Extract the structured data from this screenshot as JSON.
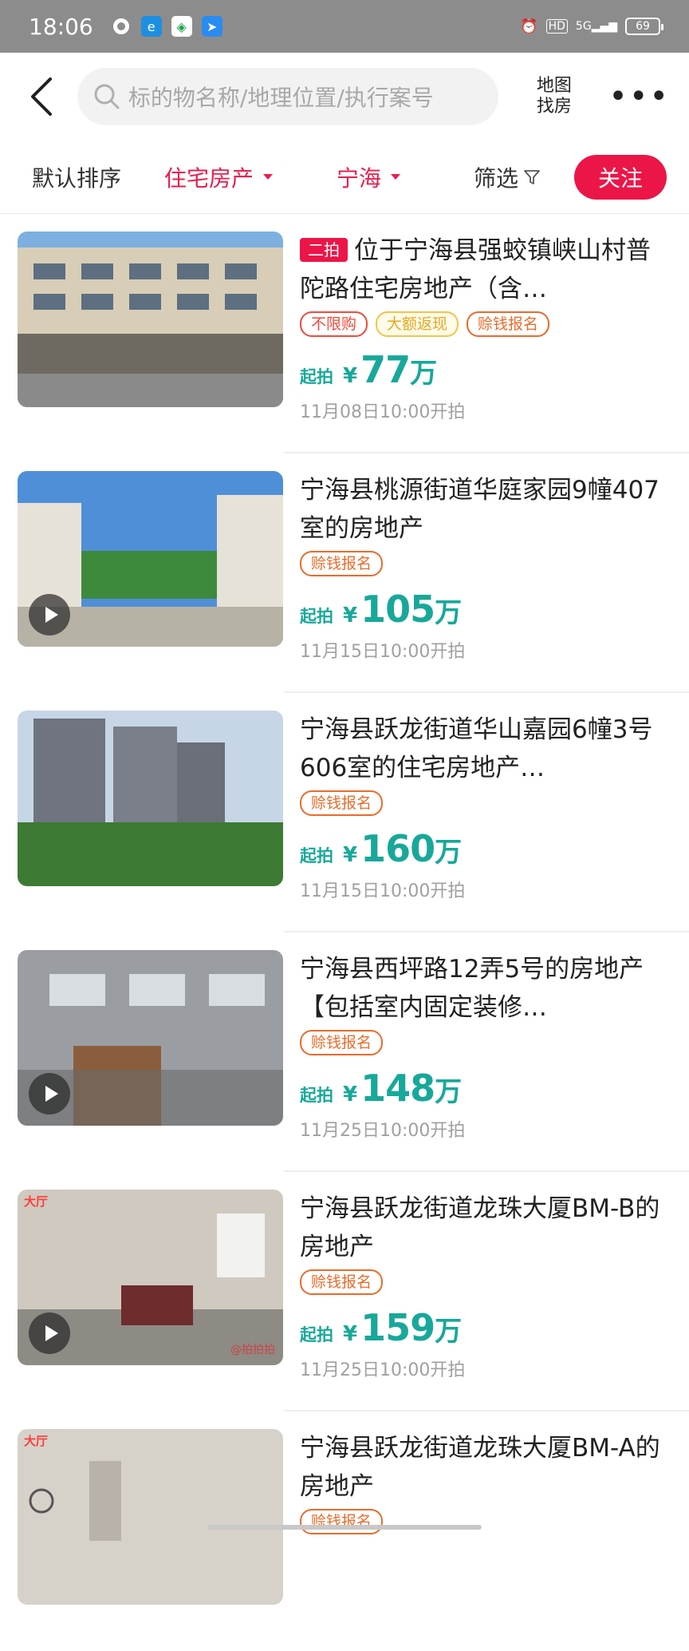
{
  "status_bar": {
    "time": "18:06",
    "signal": "5G",
    "hd": "HD",
    "battery": "69"
  },
  "header": {
    "search_placeholder": "标的物名称/地理位置/执行案号",
    "map_label_line1": "地图",
    "map_label_line2": "找房"
  },
  "filters": {
    "sort": "默认排序",
    "category": "住宅房产",
    "region": "宁海",
    "filter": "筛选",
    "follow": "关注"
  },
  "price_label": "起拍",
  "currency": "¥",
  "unit": "万",
  "listings": [
    {
      "badge": "二拍",
      "title": "位于宁海县强蛟镇峡山村普陀路住宅房地产（含…",
      "tags": [
        "不限购",
        "大额返现",
        "赊钱报名"
      ],
      "price": "77",
      "time": "11月08日10:00开拍",
      "has_video": false
    },
    {
      "badge": "",
      "title": "宁海县桃源街道华庭家园9幢407室的房地产",
      "tags": [
        "赊钱报名"
      ],
      "price": "105",
      "time": "11月15日10:00开拍",
      "has_video": true
    },
    {
      "badge": "",
      "title": "宁海县跃龙街道华山嘉园6幢3号606室的住宅房地产…",
      "tags": [
        "赊钱报名"
      ],
      "price": "160",
      "time": "11月15日10:00开拍",
      "has_video": false
    },
    {
      "badge": "",
      "title": "宁海县西坪路12弄5号的房地产【包括室内固定装修…",
      "tags": [
        "赊钱报名"
      ],
      "price": "148",
      "time": "11月25日10:00开拍",
      "has_video": true
    },
    {
      "badge": "",
      "title": "宁海县跃龙街道龙珠大厦BM-B的房地产",
      "tags": [
        "赊钱报名"
      ],
      "price": "159",
      "time": "11月25日10:00开拍",
      "has_video": true,
      "room_label": "大厅",
      "watermark": "@拍拍拍"
    },
    {
      "badge": "",
      "title": "宁海县跃龙街道龙珠大厦BM-A的房地产",
      "tags": [
        "赊钱报名"
      ],
      "price": "",
      "time": "",
      "has_video": false,
      "room_label": "大厅"
    }
  ]
}
